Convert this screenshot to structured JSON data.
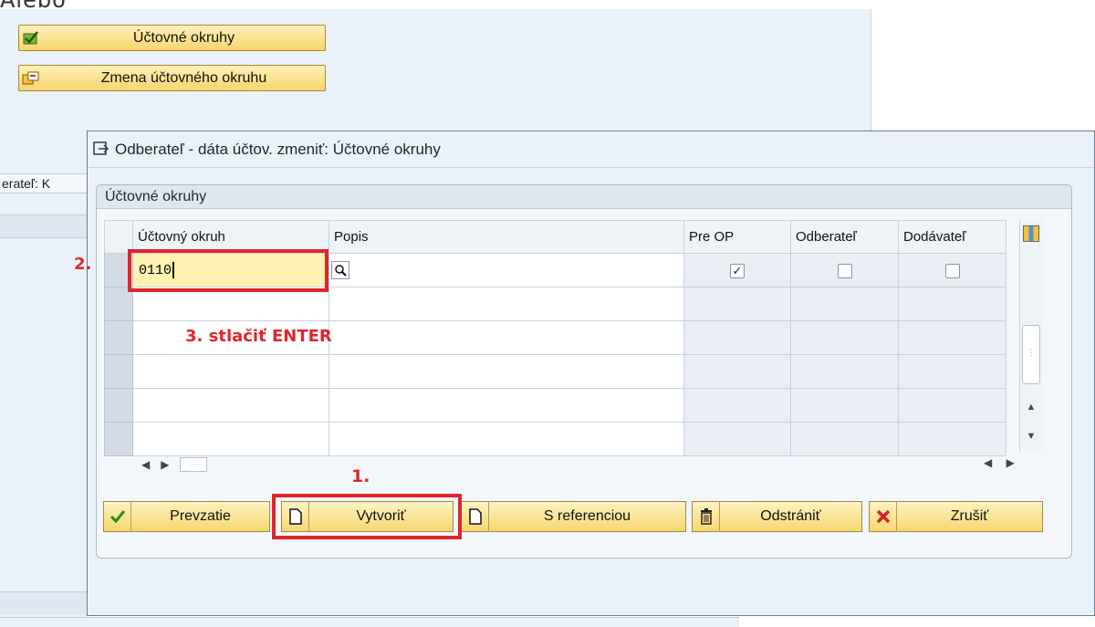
{
  "heading_fragment": "Alebo",
  "background": {
    "buttons": [
      {
        "label": "Účtovné okruhy",
        "icon": "check-green-icon"
      },
      {
        "label": "Zmena účtovného okruhu",
        "icon": "switch-icon"
      }
    ],
    "field_label_fragment": "erateľ: K"
  },
  "dialog": {
    "title": "Odberateľ - dáta účtov. zmeniť: Účtovné okruhy",
    "group_title": "Účtovné okruhy",
    "columns": [
      "Účtovný okruh",
      "Popis",
      "Pre OP",
      "Odberateľ",
      "Dodávateľ"
    ],
    "rows": [
      {
        "okruh": "0110",
        "popis": "",
        "pre_op": true,
        "odberatel": false,
        "dodavatel": false
      },
      {
        "okruh": "",
        "popis": ""
      },
      {
        "okruh": "",
        "popis": ""
      },
      {
        "okruh": "",
        "popis": ""
      },
      {
        "okruh": "",
        "popis": ""
      },
      {
        "okruh": "",
        "popis": ""
      }
    ],
    "buttons": [
      {
        "label": "Prevzatie",
        "icon": "checkmark-icon"
      },
      {
        "label": "Vytvoriť",
        "icon": "new-document-icon"
      },
      {
        "label": "S referenciou",
        "icon": "new-document-icon"
      },
      {
        "label": "Odstrániť",
        "icon": "trash-icon"
      },
      {
        "label": "Zrušiť",
        "icon": "cancel-x-icon"
      }
    ]
  },
  "annotations": {
    "step1": "1.",
    "step2": "2.",
    "step3": "3. stlačiť ENTER"
  },
  "colors": {
    "annotation_red": "#e0252b",
    "button_yellow": "#f6d770",
    "panel_blue": "#eaf1f8"
  }
}
